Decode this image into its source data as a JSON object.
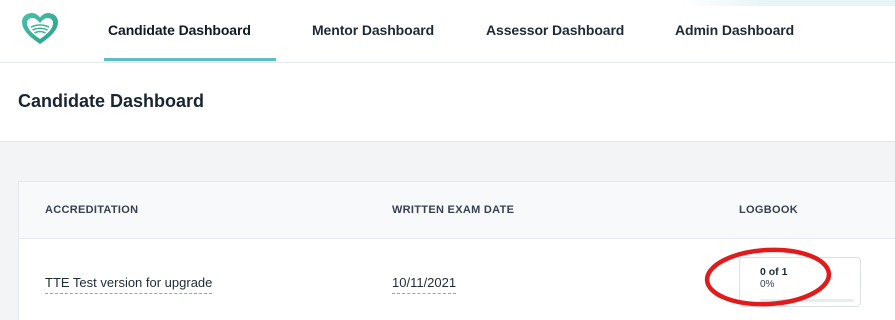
{
  "nav": {
    "tabs": [
      {
        "label": "Candidate Dashboard",
        "active": true
      },
      {
        "label": "Mentor Dashboard",
        "active": false
      },
      {
        "label": "Assessor Dashboard",
        "active": false
      },
      {
        "label": "Admin Dashboard",
        "active": false
      }
    ]
  },
  "page": {
    "title": "Candidate Dashboard"
  },
  "table": {
    "columns": [
      "ACCREDITATION",
      "WRITTEN EXAM DATE",
      "LOGBOOK"
    ],
    "rows": [
      {
        "accreditation": "TTE Test version for upgrade",
        "written_exam_date": "10/11/2021",
        "logbook": {
          "count_text": "0 of 1",
          "percent_text": "0%",
          "progress_fraction": 0
        }
      }
    ]
  },
  "colors": {
    "accent": "#5bbdc8",
    "logo_green": "#3fb39a",
    "annotation_red": "#e01b1b"
  },
  "icons": {
    "logo": "heart-logo-icon"
  }
}
